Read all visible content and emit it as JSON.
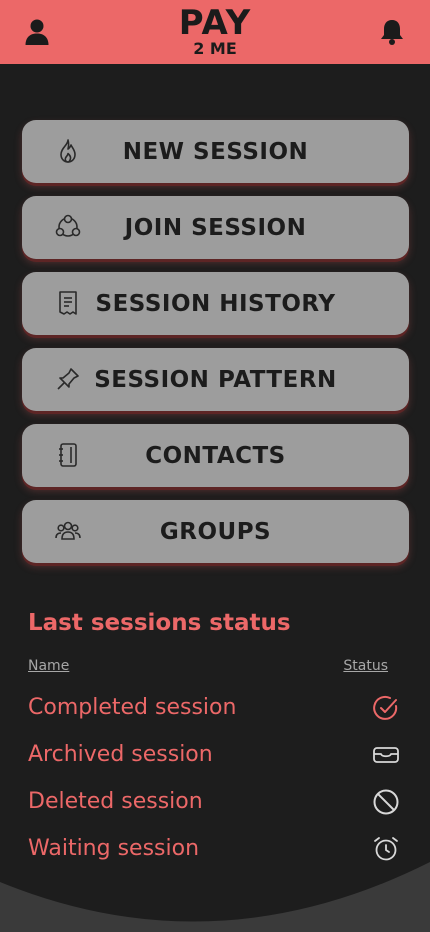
{
  "header": {
    "logo_main": "PAY",
    "logo_sub": "2 ME",
    "user_icon": "user-icon",
    "notification_icon": "bell-icon",
    "background_color": "#ec6868"
  },
  "menu": [
    {
      "label": "NEW SESSION",
      "icon": "flame-icon"
    },
    {
      "label": "JOIN SESSION",
      "icon": "group-circle-icon"
    },
    {
      "label": "SESSION HISTORY",
      "icon": "receipt-icon"
    },
    {
      "label": "SESSION PATTERN",
      "icon": "pin-icon"
    },
    {
      "label": "CONTACTS",
      "icon": "address-book-icon"
    },
    {
      "label": "GROUPS",
      "icon": "users-icon"
    }
  ],
  "status_section": {
    "title": "Last sessions status",
    "col_name": "Name",
    "col_status": "Status",
    "rows": [
      {
        "name": "Completed session",
        "icon": "check-circle-icon"
      },
      {
        "name": "Archived session",
        "icon": "inbox-icon"
      },
      {
        "name": "Deleted session",
        "icon": "ban-icon"
      },
      {
        "name": "Waiting session",
        "icon": "alarm-clock-icon"
      }
    ]
  },
  "colors": {
    "accent": "#ec6868",
    "background": "#1d1d1d",
    "button": "#9d9d9d",
    "wave": "#3a3a3a"
  }
}
